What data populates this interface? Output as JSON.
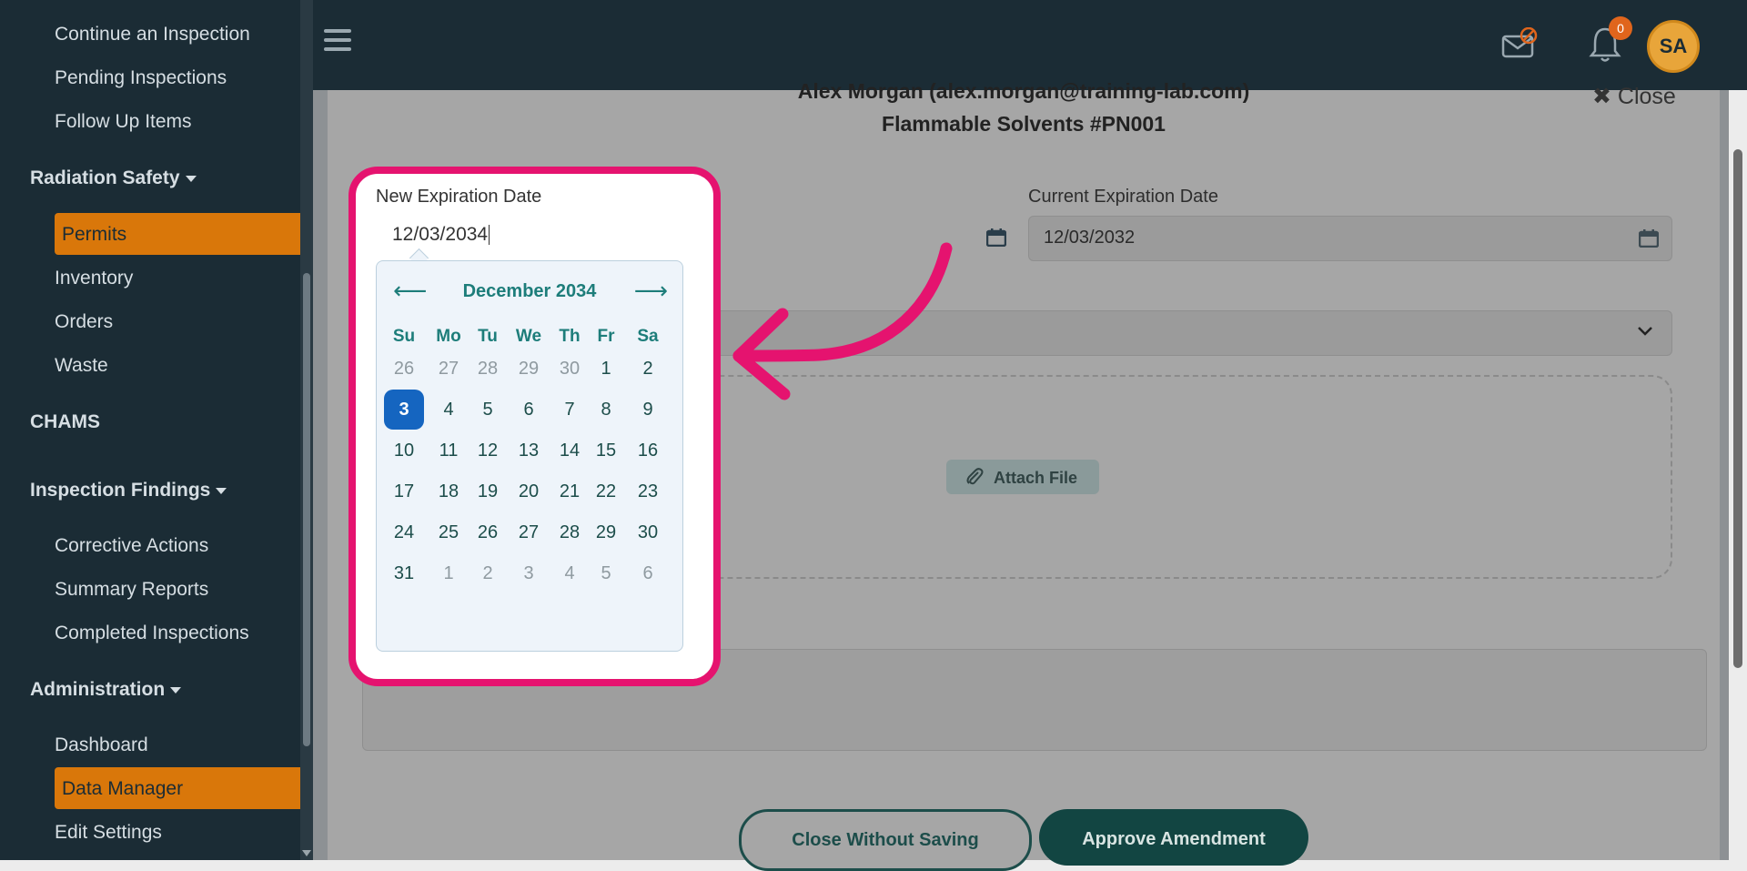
{
  "sidebar": {
    "items": {
      "continue": "Continue an Inspection",
      "pending": "Pending Inspections",
      "followup": "Follow Up Items",
      "radiation": "Radiation Safety",
      "permits": "Permits",
      "inventory": "Inventory",
      "orders": "Orders",
      "waste": "Waste",
      "chams": "CHAMS",
      "findings": "Inspection Findings",
      "corrective": "Corrective Actions",
      "summary": "Summary Reports",
      "completed": "Completed Inspections",
      "administration": "Administration",
      "dashboard": "Dashboard",
      "datamanager": "Data Manager",
      "editsettings": "Edit Settings"
    }
  },
  "topbar": {
    "notification_count": "0",
    "avatar_initials": "SA"
  },
  "modal": {
    "header_line1": "Alex Morgan (alex.morgan@training-lab.com)",
    "header_line2": "Flammable Solvents #PN001",
    "close_label": "Close",
    "current_exp_label": "Current Expiration Date",
    "current_exp_value": "12/03/2032",
    "attach_label": "Attach File",
    "btn_close_without_saving": "Close Without Saving",
    "btn_approve": "Approve Amendment"
  },
  "datepicker": {
    "label": "New Expiration Date",
    "input_value": "12/03/2034",
    "month_title": "December 2034",
    "weekdays": [
      "Su",
      "Mo",
      "Tu",
      "We",
      "Th",
      "Fr",
      "Sa"
    ],
    "weeks": [
      [
        "26",
        "27",
        "28",
        "29",
        "30",
        "1",
        "2"
      ],
      [
        "3",
        "4",
        "5",
        "6",
        "7",
        "8",
        "9"
      ],
      [
        "10",
        "11",
        "12",
        "13",
        "14",
        "15",
        "16"
      ],
      [
        "17",
        "18",
        "19",
        "20",
        "21",
        "22",
        "23"
      ],
      [
        "24",
        "25",
        "26",
        "27",
        "28",
        "29",
        "30"
      ],
      [
        "31",
        "1",
        "2",
        "3",
        "4",
        "5",
        "6"
      ]
    ],
    "selected_day": "3",
    "accent_color": "#1d7d7a",
    "selected_color": "#1565c0",
    "highlight_color": "#e5136f"
  }
}
